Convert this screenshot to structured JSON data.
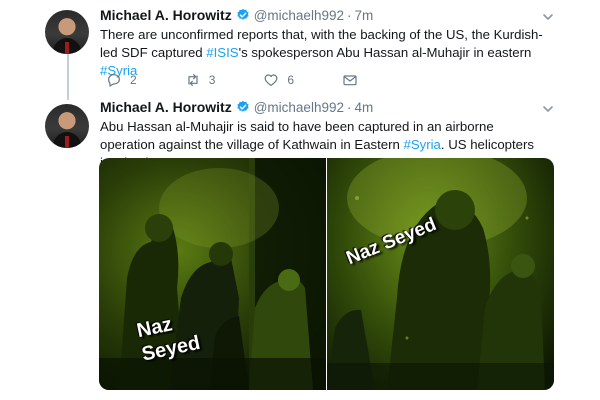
{
  "tweets": [
    {
      "author_name": "Michael A. Horowitz",
      "handle": "@michaelh992",
      "separator": "·",
      "time": "7m",
      "text_parts": [
        {
          "text": "There are unconfirmed reports that, with the backing of the US, the Kurdish-led SDF captured ",
          "highlight": false
        },
        {
          "text": "#ISIS",
          "highlight": true
        },
        {
          "text": "'s spokesperson Abu Hassan al-Muhajir in eastern ",
          "highlight": false
        },
        {
          "text": "#Syria",
          "highlight": true
        }
      ],
      "actions": {
        "reply_count": "2",
        "retweet_count": "3",
        "like_count": "6"
      }
    },
    {
      "author_name": "Michael A. Horowitz",
      "handle": "@michaelh992",
      "separator": "·",
      "time": "4m",
      "text_parts": [
        {
          "text": "Abu Hassan al-Muhajir is said to have been captured in an airborne operation against the village of Kathwain in Eastern ",
          "highlight": false
        },
        {
          "text": "#Syria",
          "highlight": true
        },
        {
          "text": ". US helicopters involved",
          "highlight": false
        }
      ],
      "media": {
        "left_watermark": "Naz\nSeyed",
        "right_watermark": "Naz Seyed"
      }
    }
  ],
  "colors": {
    "link": "#1da1f2",
    "secondary_text": "#657786",
    "verified_badge": "#1da1f2",
    "night_vision_green": "#6a8d19"
  },
  "icons": {
    "verified": "verified-badge-icon",
    "caret": "chevron-down-icon",
    "reply": "reply-icon",
    "retweet": "retweet-icon",
    "like": "heart-icon",
    "message": "envelope-icon"
  }
}
